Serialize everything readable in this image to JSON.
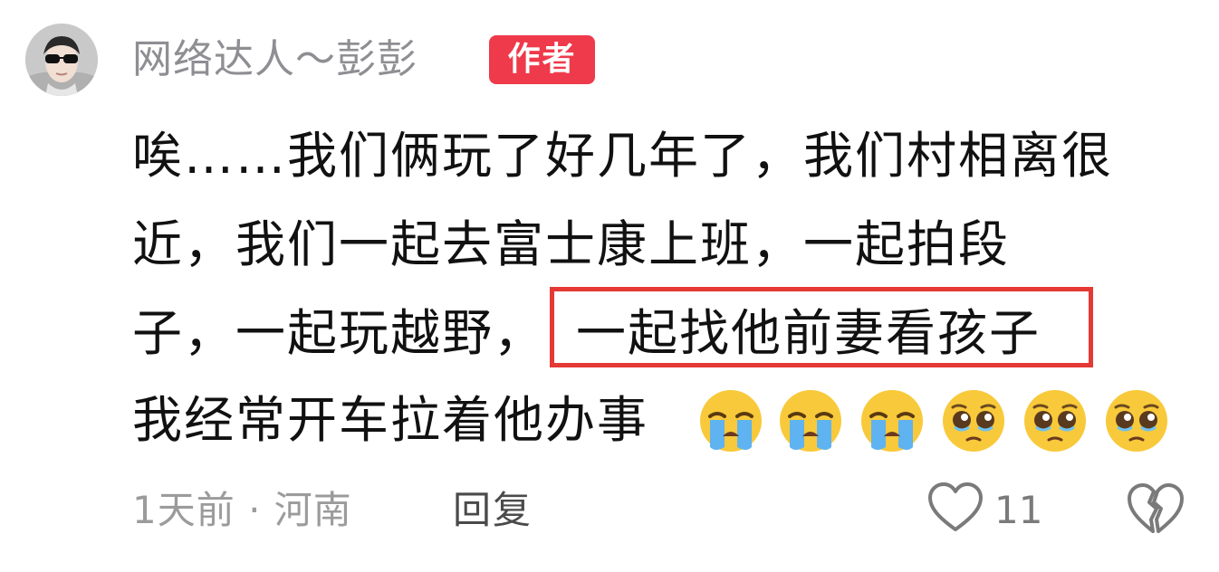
{
  "comment": {
    "username": "网络达人～彭彭",
    "badge": "作者",
    "avatar_icon": "avatar-sunglasses",
    "lines": [
      "唉……我们俩玩了好几年了，我们村相离很",
      "近，我们一起去富士康上班，一起拍段",
      "子，一起玩越野，",
      "我经常开车拉着他办事"
    ],
    "highlighted": "一起找他前妻看孩子",
    "emojis": [
      "crying-face-icon",
      "crying-face-icon",
      "crying-face-icon",
      "pleading-face-icon",
      "pleading-face-icon",
      "pleading-face-icon"
    ],
    "meta": "1天前 · 河南",
    "reply_label": "回复",
    "like_count": "11",
    "colors": {
      "badge": "#ee3a4a",
      "highlight_border": "#e53935",
      "meta_text": "#9b9b9b"
    }
  }
}
